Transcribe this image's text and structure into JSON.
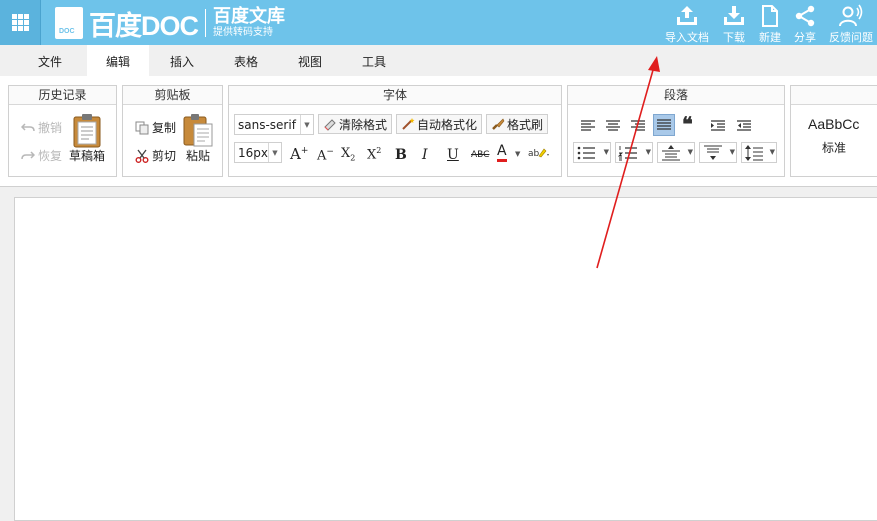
{
  "header": {
    "logo_badge": "DOC",
    "logo_name": "百度DOC",
    "product_title": "百度文库",
    "product_tagline": "提供转码支持",
    "actions": [
      {
        "label": "导入文档",
        "icon": "import-icon"
      },
      {
        "label": "下载",
        "icon": "download-icon"
      },
      {
        "label": "新建",
        "icon": "new-file-icon"
      },
      {
        "label": "分享",
        "icon": "share-icon"
      },
      {
        "label": "反馈问题",
        "icon": "feedback-icon"
      }
    ],
    "colors": {
      "bar": "#6ec3ea",
      "grid_button": "#5bb3dd"
    }
  },
  "tabs": [
    "文件",
    "编辑",
    "插入",
    "表格",
    "视图",
    "工具"
  ],
  "active_tab": "编辑",
  "ribbon": {
    "history": {
      "title": "历史记录",
      "undo": "撤销",
      "redo": "恢复",
      "drafts": "草稿箱"
    },
    "clipboard": {
      "title": "剪贴板",
      "copy": "复制",
      "cut": "剪切",
      "paste": "粘贴"
    },
    "font": {
      "title": "字体",
      "family": "sans-serif",
      "size": "16px",
      "clear_format": "清除格式",
      "auto_format": "自动格式化",
      "format_painter": "格式刷",
      "bold": "B",
      "italic": "I",
      "underline": "U",
      "strike": "ABC",
      "font_color": "A",
      "increase_size": "A",
      "decrease_size": "A",
      "subscript": "X",
      "superscript": "X",
      "superscript_mark": "2",
      "subscript_mark": "2"
    },
    "paragraph": {
      "title": "段落"
    },
    "styles": {
      "sample": "AaBbCc",
      "name": "标准"
    }
  },
  "annotation": {
    "type": "arrow",
    "color": "#e01e1e"
  }
}
